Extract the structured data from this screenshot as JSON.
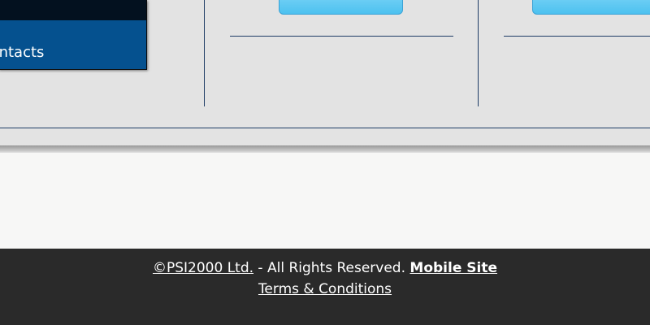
{
  "nav": {
    "item_label": "Contacts"
  },
  "footer": {
    "copyright_link": "©PSI2000 Ltd.",
    "rights_text": " - All Rights Reserved. ",
    "mobile_link": "Mobile Site",
    "terms_link": "Terms & Conditions"
  },
  "colors": {
    "nav_dark": "#03111f",
    "nav_blue": "#05518f",
    "divider": "#1f3d66",
    "tab_blue": "#4cc1ef",
    "footer_bg": "#2a2a2a",
    "page_bg": "#e3e3e3"
  }
}
